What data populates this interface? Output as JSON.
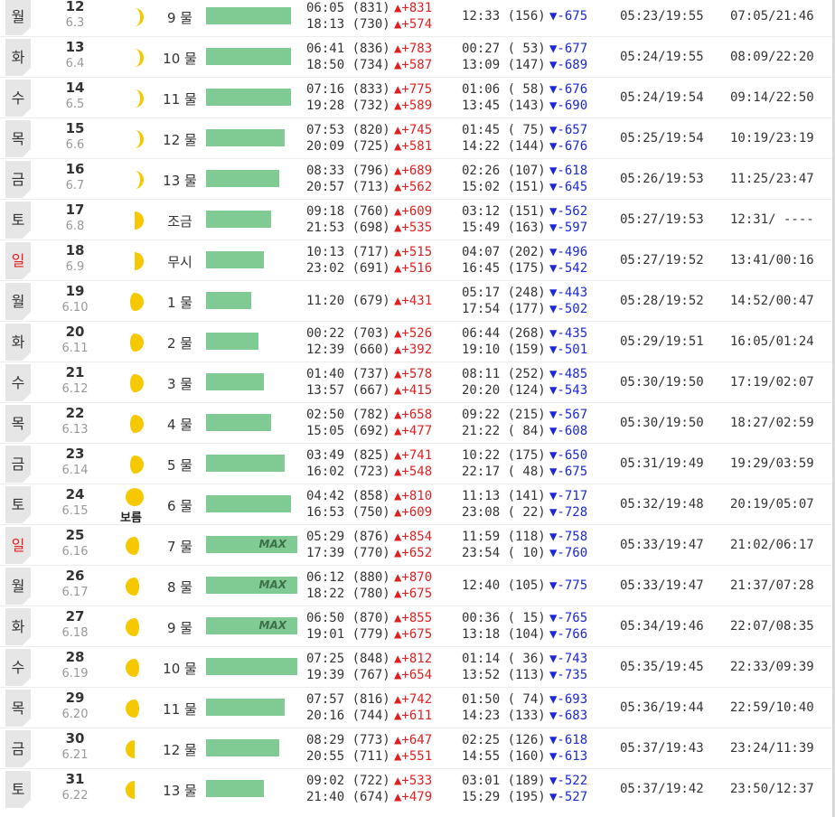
{
  "colors": {
    "flood": "#e02020",
    "ebb": "#1a28d8",
    "bar": "#7fcb93",
    "moon": "#f5c800"
  },
  "full_moon_label": "보름",
  "max_label": "MAX",
  "rows": [
    {
      "dow": "월",
      "day": "12",
      "lunar": "6.3",
      "mul": "9 물",
      "bar": 0.735,
      "max": false,
      "moon": "waxing-crescent",
      "hi": [
        {
          "text": "06:05 (831)",
          "diff": "▲+831",
          "dir": "up"
        },
        {
          "text": "18:13 (730)",
          "diff": "▲+574",
          "dir": "up"
        }
      ],
      "lo": [
        {
          "text": "12:33 (156)",
          "diff": "▼-675",
          "dir": "dn"
        }
      ],
      "sun": "05:23/19:55",
      "moonrise": "07:05/21:46"
    },
    {
      "dow": "화",
      "day": "13",
      "lunar": "6.4",
      "mul": "10 물",
      "bar": 0.735,
      "max": false,
      "moon": "waxing-crescent",
      "hi": [
        {
          "text": "06:41 (836)",
          "diff": "▲+783",
          "dir": "up"
        },
        {
          "text": "18:50 (734)",
          "diff": "▲+587",
          "dir": "up"
        }
      ],
      "lo": [
        {
          "text": "00:27 ( 53)",
          "diff": "▼-677",
          "dir": "dn"
        },
        {
          "text": "13:09 (147)",
          "diff": "▼-689",
          "dir": "dn"
        }
      ],
      "sun": "05:24/19:55",
      "moonrise": "08:09/22:20"
    },
    {
      "dow": "수",
      "day": "14",
      "lunar": "6.5",
      "mul": "11 물",
      "bar": 0.735,
      "max": false,
      "moon": "waxing-crescent",
      "hi": [
        {
          "text": "07:16 (833)",
          "diff": "▲+775",
          "dir": "up"
        },
        {
          "text": "19:28 (732)",
          "diff": "▲+589",
          "dir": "up"
        }
      ],
      "lo": [
        {
          "text": "01:06 ( 58)",
          "diff": "▼-676",
          "dir": "dn"
        },
        {
          "text": "13:45 (143)",
          "diff": "▼-690",
          "dir": "dn"
        }
      ],
      "sun": "05:24/19:54",
      "moonrise": "09:14/22:50"
    },
    {
      "dow": "목",
      "day": "15",
      "lunar": "6.6",
      "mul": "12 물",
      "bar": 0.68,
      "max": false,
      "moon": "waxing-crescent",
      "hi": [
        {
          "text": "07:53 (820)",
          "diff": "▲+745",
          "dir": "up"
        },
        {
          "text": "20:09 (725)",
          "diff": "▲+581",
          "dir": "up"
        }
      ],
      "lo": [
        {
          "text": "01:45 ( 75)",
          "diff": "▼-657",
          "dir": "dn"
        },
        {
          "text": "14:22 (144)",
          "diff": "▼-676",
          "dir": "dn"
        }
      ],
      "sun": "05:25/19:54",
      "moonrise": "10:19/23:19"
    },
    {
      "dow": "금",
      "day": "16",
      "lunar": "6.7",
      "mul": "13 물",
      "bar": 0.63,
      "max": false,
      "moon": "waxing-crescent",
      "hi": [
        {
          "text": "08:33 (796)",
          "diff": "▲+689",
          "dir": "up"
        },
        {
          "text": "20:57 (713)",
          "diff": "▲+562",
          "dir": "up"
        }
      ],
      "lo": [
        {
          "text": "02:26 (107)",
          "diff": "▼-618",
          "dir": "dn"
        },
        {
          "text": "15:02 (151)",
          "diff": "▼-645",
          "dir": "dn"
        }
      ],
      "sun": "05:26/19:53",
      "moonrise": "11:25/23:47"
    },
    {
      "dow": "토",
      "day": "17",
      "lunar": "6.8",
      "mul": "조금",
      "bar": 0.56,
      "max": false,
      "moon": "first-quarter",
      "hi": [
        {
          "text": "09:18 (760)",
          "diff": "▲+609",
          "dir": "up"
        },
        {
          "text": "21:53 (698)",
          "diff": "▲+535",
          "dir": "up"
        }
      ],
      "lo": [
        {
          "text": "03:12 (151)",
          "diff": "▼-562",
          "dir": "dn"
        },
        {
          "text": "15:49 (163)",
          "diff": "▼-597",
          "dir": "dn"
        }
      ],
      "sun": "05:27/19:53",
      "moonrise": "12:31/ ----"
    },
    {
      "dow": "일",
      "day": "18",
      "lunar": "6.9",
      "mul": "무시",
      "bar": 0.5,
      "max": false,
      "moon": "first-quarter",
      "hi": [
        {
          "text": "10:13 (717)",
          "diff": "▲+515",
          "dir": "up"
        },
        {
          "text": "23:02 (691)",
          "diff": "▲+516",
          "dir": "up"
        }
      ],
      "lo": [
        {
          "text": "04:07 (202)",
          "diff": "▼-496",
          "dir": "dn"
        },
        {
          "text": "16:45 (175)",
          "diff": "▼-542",
          "dir": "dn"
        }
      ],
      "sun": "05:27/19:52",
      "moonrise": "13:41/00:16"
    },
    {
      "dow": "월",
      "day": "19",
      "lunar": "6.10",
      "mul": "1 물",
      "bar": 0.39,
      "max": false,
      "moon": "waxing-gibbous",
      "hi": [
        {
          "text": "11:20 (679)",
          "diff": "▲+431",
          "dir": "up"
        }
      ],
      "lo": [
        {
          "text": "05:17 (248)",
          "diff": "▼-443",
          "dir": "dn"
        },
        {
          "text": "17:54 (177)",
          "diff": "▼-502",
          "dir": "dn"
        }
      ],
      "sun": "05:28/19:52",
      "moonrise": "14:52/00:47"
    },
    {
      "dow": "화",
      "day": "20",
      "lunar": "6.11",
      "mul": "2 물",
      "bar": 0.45,
      "max": false,
      "moon": "waxing-gibbous",
      "hi": [
        {
          "text": "00:22 (703)",
          "diff": "▲+526",
          "dir": "up"
        },
        {
          "text": "12:39 (660)",
          "diff": "▲+392",
          "dir": "up"
        }
      ],
      "lo": [
        {
          "text": "06:44 (268)",
          "diff": "▼-435",
          "dir": "dn"
        },
        {
          "text": "19:10 (159)",
          "diff": "▼-501",
          "dir": "dn"
        }
      ],
      "sun": "05:29/19:51",
      "moonrise": "16:05/01:24"
    },
    {
      "dow": "수",
      "day": "21",
      "lunar": "6.12",
      "mul": "3 물",
      "bar": 0.5,
      "max": false,
      "moon": "waxing-gibbous",
      "hi": [
        {
          "text": "01:40 (737)",
          "diff": "▲+578",
          "dir": "up"
        },
        {
          "text": "13:57 (667)",
          "diff": "▲+415",
          "dir": "up"
        }
      ],
      "lo": [
        {
          "text": "08:11 (252)",
          "diff": "▼-485",
          "dir": "dn"
        },
        {
          "text": "20:20 (124)",
          "diff": "▼-543",
          "dir": "dn"
        }
      ],
      "sun": "05:30/19:50",
      "moonrise": "17:19/02:07"
    },
    {
      "dow": "목",
      "day": "22",
      "lunar": "6.13",
      "mul": "4 물",
      "bar": 0.56,
      "max": false,
      "moon": "waxing-gibbous",
      "hi": [
        {
          "text": "02:50 (782)",
          "diff": "▲+658",
          "dir": "up"
        },
        {
          "text": "15:05 (692)",
          "diff": "▲+477",
          "dir": "up"
        }
      ],
      "lo": [
        {
          "text": "09:22 (215)",
          "diff": "▼-567",
          "dir": "dn"
        },
        {
          "text": "21:22 ( 84)",
          "diff": "▼-608",
          "dir": "dn"
        }
      ],
      "sun": "05:30/19:50",
      "moonrise": "18:27/02:59"
    },
    {
      "dow": "금",
      "day": "23",
      "lunar": "6.14",
      "mul": "5 물",
      "bar": 0.68,
      "max": false,
      "moon": "waxing-gibbous",
      "hi": [
        {
          "text": "03:49 (825)",
          "diff": "▲+741",
          "dir": "up"
        },
        {
          "text": "16:02 (723)",
          "diff": "▲+548",
          "dir": "up"
        }
      ],
      "lo": [
        {
          "text": "10:22 (175)",
          "diff": "▼-650",
          "dir": "dn"
        },
        {
          "text": "22:17 ( 48)",
          "diff": "▼-675",
          "dir": "dn"
        }
      ],
      "sun": "05:31/19:49",
      "moonrise": "19:29/03:59"
    },
    {
      "dow": "토",
      "day": "24",
      "lunar": "6.15",
      "mul": "6 물",
      "bar": 0.735,
      "max": false,
      "moon": "full",
      "hi": [
        {
          "text": "04:42 (858)",
          "diff": "▲+810",
          "dir": "up"
        },
        {
          "text": "16:53 (750)",
          "diff": "▲+609",
          "dir": "up"
        }
      ],
      "lo": [
        {
          "text": "11:13 (141)",
          "diff": "▼-717",
          "dir": "dn"
        },
        {
          "text": "23:08 ( 22)",
          "diff": "▼-728",
          "dir": "dn"
        }
      ],
      "sun": "05:32/19:48",
      "moonrise": "20:19/05:07"
    },
    {
      "dow": "일",
      "day": "25",
      "lunar": "6.16",
      "mul": "7 물",
      "bar": 0.79,
      "max": true,
      "moon": "waning-gibbous",
      "hi": [
        {
          "text": "05:29 (876)",
          "diff": "▲+854",
          "dir": "up"
        },
        {
          "text": "17:39 (770)",
          "diff": "▲+652",
          "dir": "up"
        }
      ],
      "lo": [
        {
          "text": "11:59 (118)",
          "diff": "▼-758",
          "dir": "dn"
        },
        {
          "text": "23:54 ( 10)",
          "diff": "▼-760",
          "dir": "dn"
        }
      ],
      "sun": "05:33/19:47",
      "moonrise": "21:02/06:17"
    },
    {
      "dow": "월",
      "day": "26",
      "lunar": "6.17",
      "mul": "8 물",
      "bar": 0.79,
      "max": true,
      "moon": "waning-gibbous",
      "hi": [
        {
          "text": "06:12 (880)",
          "diff": "▲+870",
          "dir": "up"
        },
        {
          "text": "18:22 (780)",
          "diff": "▲+675",
          "dir": "up"
        }
      ],
      "lo": [
        {
          "text": "12:40 (105)",
          "diff": "▼-775",
          "dir": "dn"
        }
      ],
      "sun": "05:33/19:47",
      "moonrise": "21:37/07:28"
    },
    {
      "dow": "화",
      "day": "27",
      "lunar": "6.18",
      "mul": "9 물",
      "bar": 0.79,
      "max": true,
      "moon": "waning-gibbous",
      "hi": [
        {
          "text": "06:50 (870)",
          "diff": "▲+855",
          "dir": "up"
        },
        {
          "text": "19:01 (779)",
          "diff": "▲+675",
          "dir": "up"
        }
      ],
      "lo": [
        {
          "text": "00:36 ( 15)",
          "diff": "▼-765",
          "dir": "dn"
        },
        {
          "text": "13:18 (104)",
          "diff": "▼-766",
          "dir": "dn"
        }
      ],
      "sun": "05:34/19:46",
      "moonrise": "22:07/08:35"
    },
    {
      "dow": "수",
      "day": "28",
      "lunar": "6.19",
      "mul": "10 물",
      "bar": 0.79,
      "max": false,
      "moon": "waning-gibbous",
      "hi": [
        {
          "text": "07:25 (848)",
          "diff": "▲+812",
          "dir": "up"
        },
        {
          "text": "19:39 (767)",
          "diff": "▲+654",
          "dir": "up"
        }
      ],
      "lo": [
        {
          "text": "01:14 ( 36)",
          "diff": "▼-743",
          "dir": "dn"
        },
        {
          "text": "13:52 (113)",
          "diff": "▼-735",
          "dir": "dn"
        }
      ],
      "sun": "05:35/19:45",
      "moonrise": "22:33/09:39"
    },
    {
      "dow": "목",
      "day": "29",
      "lunar": "6.20",
      "mul": "11 물",
      "bar": 0.68,
      "max": false,
      "moon": "waning-gibbous",
      "hi": [
        {
          "text": "07:57 (816)",
          "diff": "▲+742",
          "dir": "up"
        },
        {
          "text": "20:16 (744)",
          "diff": "▲+611",
          "dir": "up"
        }
      ],
      "lo": [
        {
          "text": "01:50 ( 74)",
          "diff": "▼-693",
          "dir": "dn"
        },
        {
          "text": "14:23 (133)",
          "diff": "▼-683",
          "dir": "dn"
        }
      ],
      "sun": "05:36/19:44",
      "moonrise": "22:59/10:40"
    },
    {
      "dow": "금",
      "day": "30",
      "lunar": "6.21",
      "mul": "12 물",
      "bar": 0.63,
      "max": false,
      "moon": "last-quarter",
      "hi": [
        {
          "text": "08:29 (773)",
          "diff": "▲+647",
          "dir": "up"
        },
        {
          "text": "20:55 (711)",
          "diff": "▲+551",
          "dir": "up"
        }
      ],
      "lo": [
        {
          "text": "02:25 (126)",
          "diff": "▼-618",
          "dir": "dn"
        },
        {
          "text": "14:55 (160)",
          "diff": "▼-613",
          "dir": "dn"
        }
      ],
      "sun": "05:37/19:43",
      "moonrise": "23:24/11:39"
    },
    {
      "dow": "토",
      "day": "31",
      "lunar": "6.22",
      "mul": "13 물",
      "bar": 0.5,
      "max": false,
      "moon": "last-quarter",
      "hi": [
        {
          "text": "09:02 (722)",
          "diff": "▲+533",
          "dir": "up"
        },
        {
          "text": "21:40 (674)",
          "diff": "▲+479",
          "dir": "up"
        }
      ],
      "lo": [
        {
          "text": "03:01 (189)",
          "diff": "▼-522",
          "dir": "dn"
        },
        {
          "text": "15:29 (195)",
          "diff": "▼-527",
          "dir": "dn"
        }
      ],
      "sun": "05:37/19:42",
      "moonrise": "23:50/12:37"
    }
  ]
}
